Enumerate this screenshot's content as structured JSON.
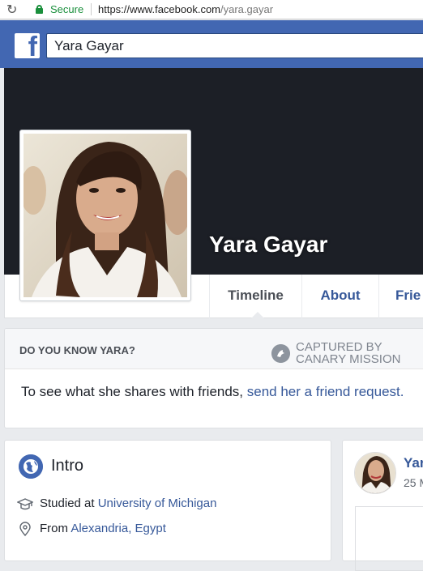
{
  "browser": {
    "secure_label": "Secure",
    "url_host": "https://www.facebook.com",
    "url_path": "/yara.gayar",
    "reload_icon": "reload-icon",
    "lock_icon": "lock-icon"
  },
  "header": {
    "logo_letter": "f",
    "search_value": "Yara Gayar"
  },
  "profile": {
    "name": "Yara Gayar"
  },
  "tabs": [
    {
      "label": "Timeline"
    },
    {
      "label": "About"
    },
    {
      "label": "Frie"
    }
  ],
  "dyk": {
    "title": "DO YOU KNOW YARA?",
    "canary_line1": "CAPTURED BY",
    "canary_line2": "CANARY MISSION",
    "body_text": "To see what she shares with friends, ",
    "body_link": "send her a friend request."
  },
  "intro": {
    "title": "Intro",
    "studied_prefix": "Studied at ",
    "studied_link": "University of Michigan",
    "from_prefix": "From ",
    "from_link": "Alexandria, Egypt"
  },
  "post": {
    "name": "Yar",
    "date": "25 M"
  },
  "colors": {
    "brand_blue": "#4267b2",
    "link_blue": "#365899",
    "secure_green": "#1a8f3c",
    "cover_dark": "#1c1f26"
  }
}
